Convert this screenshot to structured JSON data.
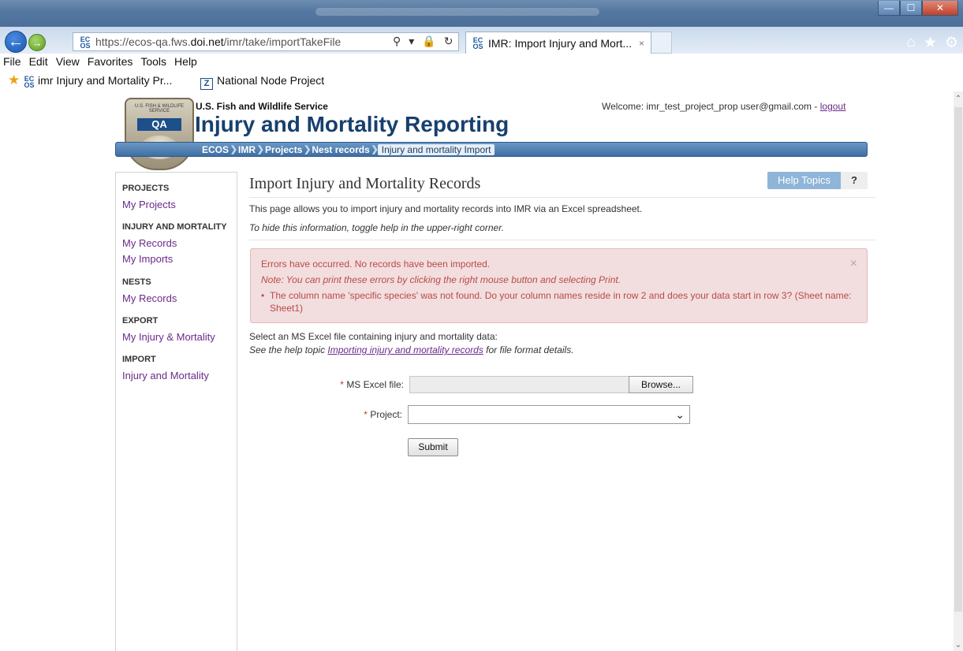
{
  "browser": {
    "url_prefix": "https://ecos-qa.fws.",
    "url_domain": "doi.net",
    "url_path": "/imr/take/importTakeFile",
    "tab_title": "IMR: Import Injury and Mort...",
    "tab_close": "×",
    "menu": [
      "File",
      "Edit",
      "View",
      "Favorites",
      "Tools",
      "Help"
    ],
    "favorites": [
      "imr Injury and Mortality Pr...",
      "National Node Project"
    ],
    "win_minimize": "—",
    "win_maximize": "☐",
    "win_close": "✕",
    "site_icon_text": "EC OS"
  },
  "header": {
    "agency": "U.S. Fish and Wildlife Service",
    "title": "Injury and Mortality Reporting",
    "welcome": "Welcome: imr_test_project_prop user@gmail.com - ",
    "logout": "logout",
    "logo_text": "U.S. FISH & WILDLIFE SERVICE",
    "logo_badge": "QA"
  },
  "breadcrumb": [
    "ECOS",
    "IMR",
    "Projects",
    "Nest records",
    "Injury and mortality Import"
  ],
  "sidebar": {
    "sections": [
      {
        "heading": "PROJECTS",
        "links": [
          "My Projects"
        ]
      },
      {
        "heading": "INJURY AND MORTALITY",
        "links": [
          "My Records",
          "My Imports"
        ]
      },
      {
        "heading": "NESTS",
        "links": [
          "My Records"
        ]
      },
      {
        "heading": "EXPORT",
        "links": [
          "My Injury & Mortality"
        ]
      },
      {
        "heading": "IMPORT",
        "links": [
          "Injury and Mortality"
        ]
      }
    ]
  },
  "main": {
    "title": "Import Injury and Mortality Records",
    "help_topics": "Help Topics",
    "help_q": "?",
    "intro": "This page allows you to import injury and mortality records into IMR via an Excel spreadsheet.",
    "intro_help": "To hide this information, toggle help in the upper-right corner.",
    "alert": {
      "line1": "Errors have occurred. No records have been imported.",
      "line2": "Note: You can print these errors by clicking the right mouse button and selecting Print.",
      "error": "The column name 'specific species' was not found. Do your column names reside in row 2 and does your data start in row 3? (Sheet name: Sheet1)",
      "bullet": "•",
      "close": "×"
    },
    "select_text": "Select an MS Excel file containing injury and mortality data:",
    "help_prefix": "See the help topic ",
    "help_link": "Importing injury and mortality records",
    "help_suffix": " for file format details.",
    "file_label": "MS Excel file:",
    "browse": "Browse...",
    "project_label": "Project:",
    "project_value": "",
    "submit": "Submit",
    "required_mark": "*"
  }
}
